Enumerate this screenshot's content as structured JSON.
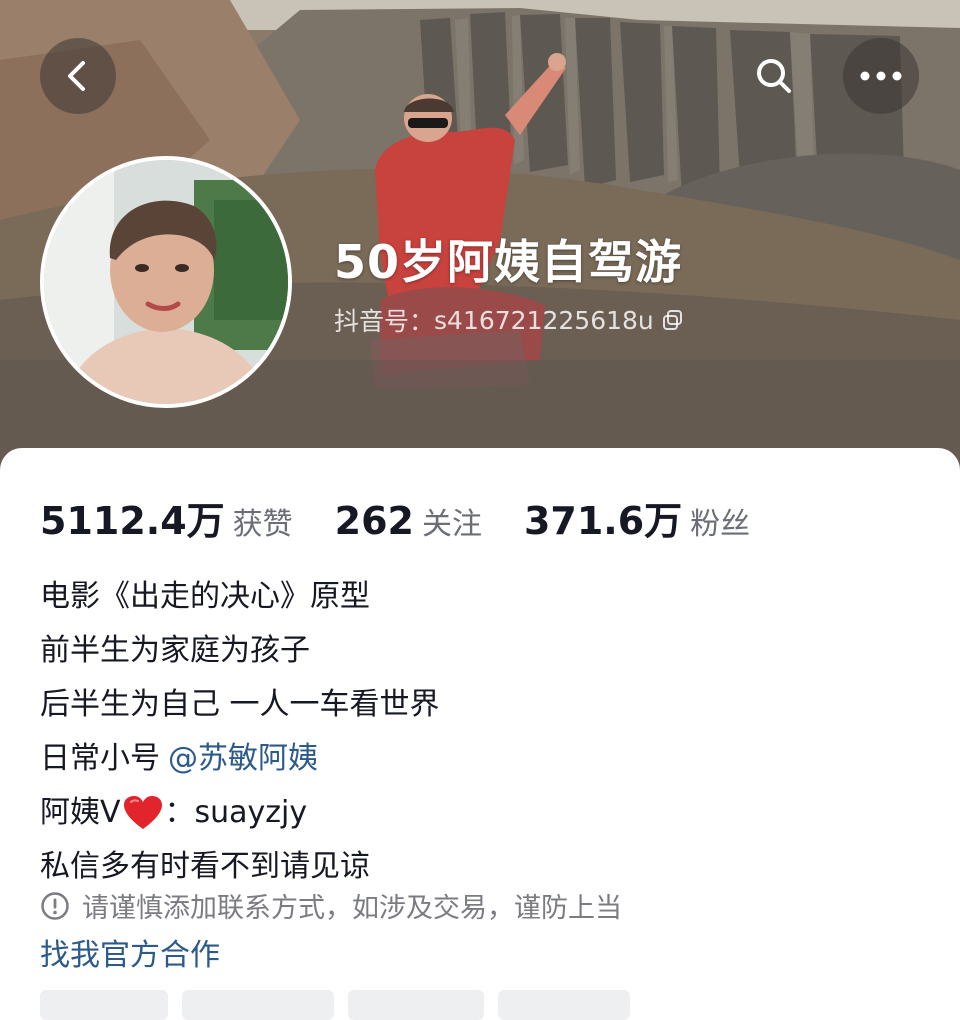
{
  "header": {
    "back_icon": "chevron-left-icon",
    "search_icon": "search-icon",
    "more_icon": "more-horizontal-icon"
  },
  "profile": {
    "nickname": "50岁阿姨自驾游",
    "douyin_id_label": "抖音号：",
    "douyin_id": "s416721225618u",
    "copy_icon": "copy-icon"
  },
  "stats": [
    {
      "value": "5112.4万",
      "label": "获赞"
    },
    {
      "value": "262",
      "label": "关注"
    },
    {
      "value": "371.6万",
      "label": "粉丝"
    }
  ],
  "bio": {
    "line1": "电影《出走的决心》原型",
    "line2": "前半生为家庭为孩子",
    "line3": "后半生为自己 一人一车看世界",
    "line4_prefix": "日常小号",
    "line4_mention": "@苏敏阿姨",
    "line5_prefix": "阿姨V",
    "line5_suffix": "：suayzjy",
    "line6": "私信多有时看不到请见谅"
  },
  "notice": {
    "icon": "info-circle-icon",
    "text": "请谨慎添加联系方式，如涉及交易，谨防上当"
  },
  "official_link": "找我官方合作",
  "colors": {
    "link": "#2c5a8a",
    "text_primary": "#161823",
    "text_secondary": "#6b6e76",
    "heart": "#e2242d"
  }
}
